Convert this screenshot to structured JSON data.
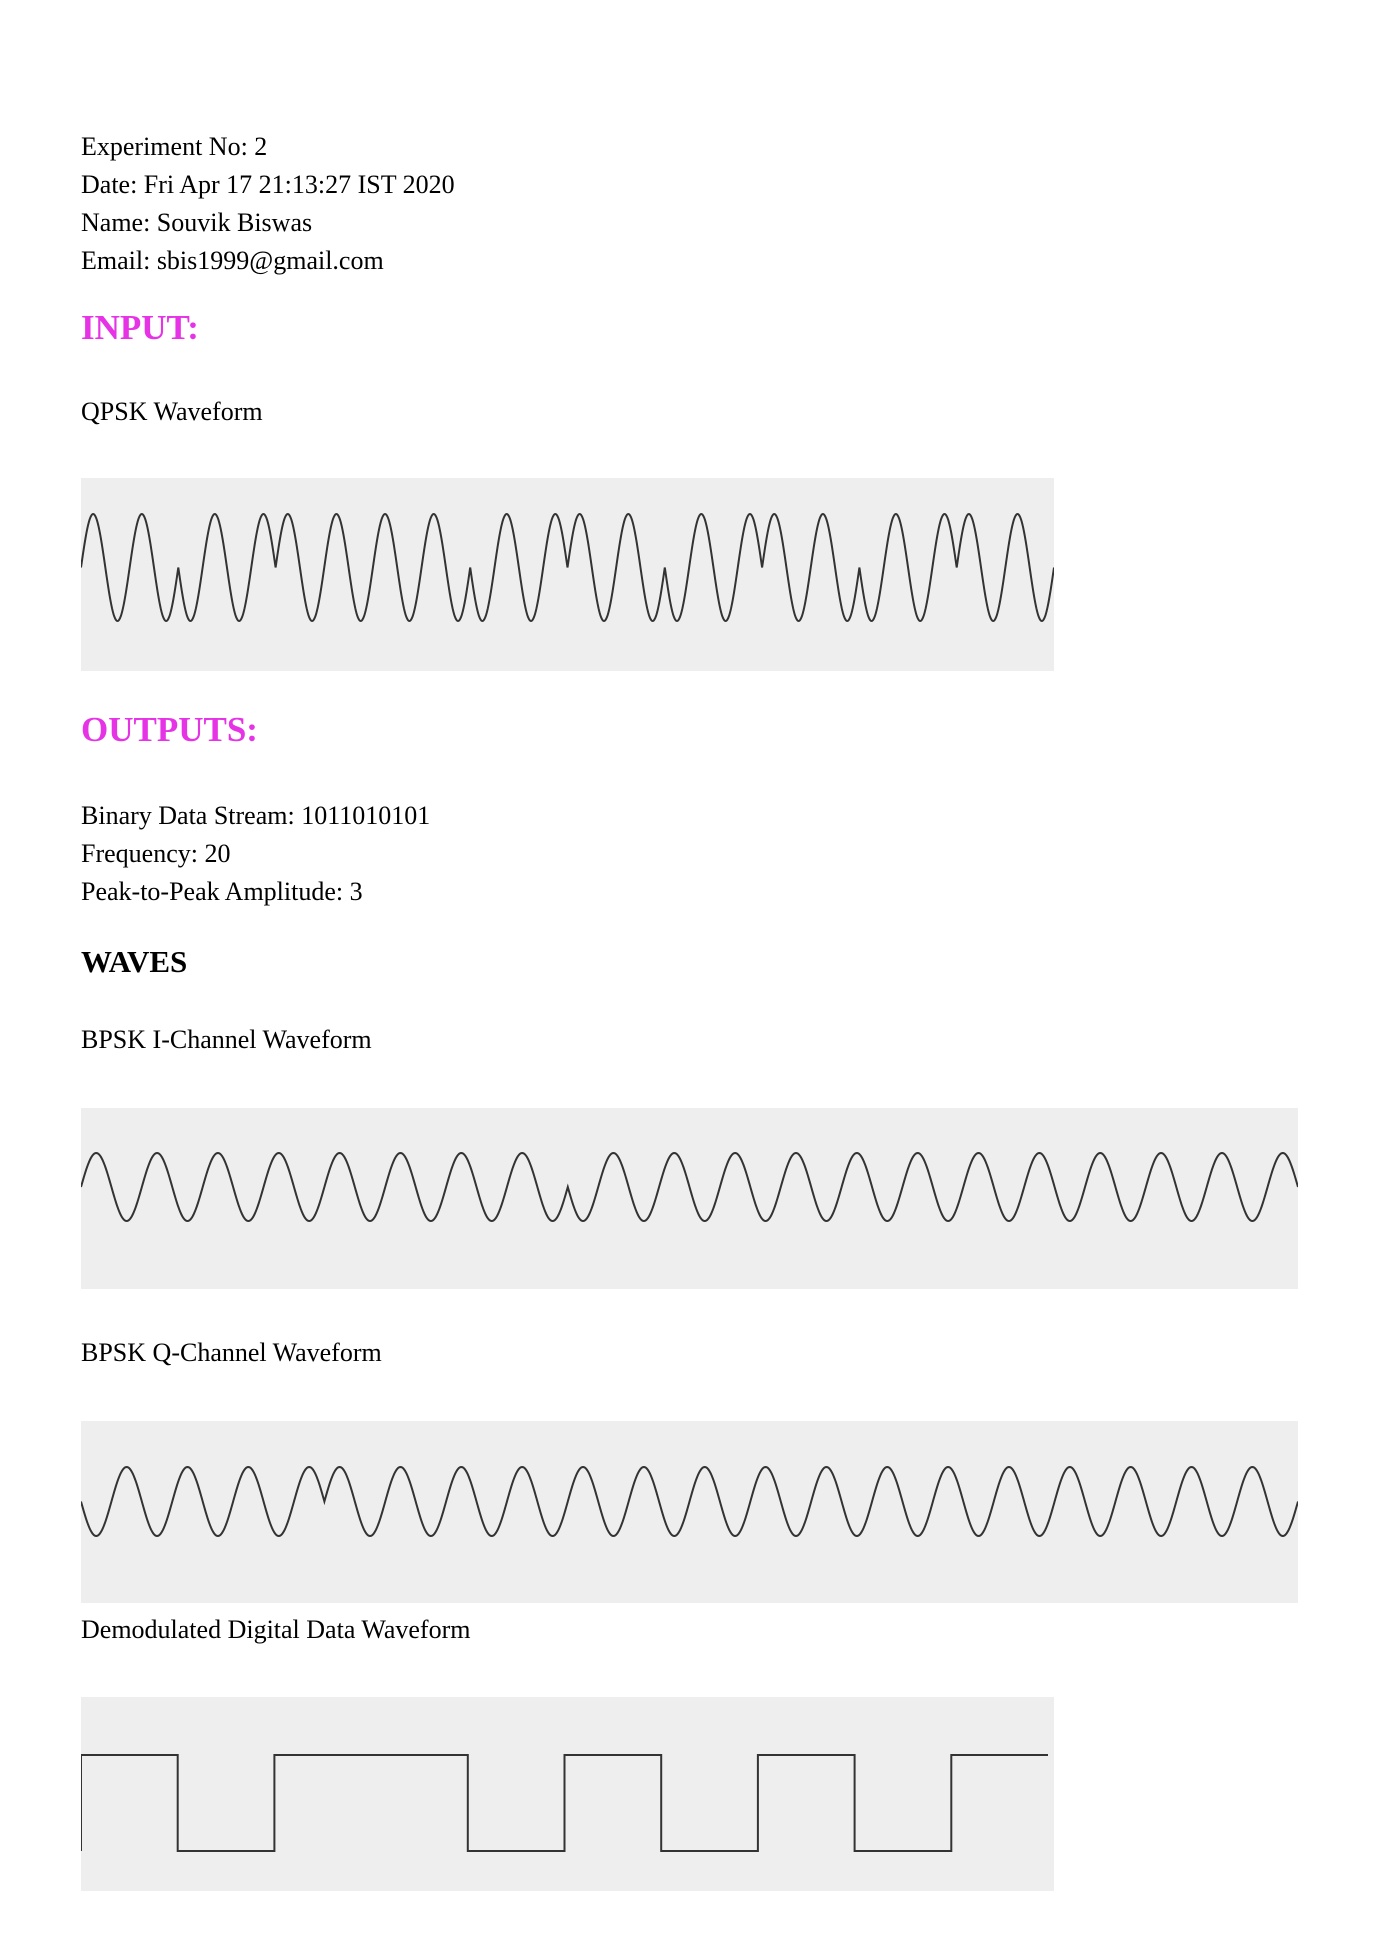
{
  "header": {
    "experiment": "Experiment No: 2",
    "date": "Date: Fri Apr 17 21:13:27 IST 2020",
    "name": "Name: Souvik Biswas",
    "email": "Email: sbis1999@gmail.com"
  },
  "colors": {
    "heading": "#e633e6",
    "wave_bg": "#eeeeee",
    "wave_stroke": "#333333"
  },
  "input": {
    "heading": "INPUT:",
    "qpsk_label": "QPSK Waveform"
  },
  "outputs": {
    "heading": "OUTPUTS:",
    "binary_stream": "Binary Data Stream: 1011010101",
    "frequency": "Frequency: 20",
    "amplitude": "Peak-to-Peak Amplitude: 3"
  },
  "waves": {
    "heading": "WAVES",
    "i_label": "BPSK I-Channel Waveform",
    "q_label": "BPSK Q-Channel Waveform",
    "demod_label": "Demodulated Digital Data Waveform"
  },
  "chart_data": [
    {
      "type": "line",
      "name_ref": "qpsk",
      "cycles": 20,
      "bits": [
        1,
        0,
        1,
        1,
        0,
        1,
        0,
        1,
        0,
        1
      ],
      "x": [
        0,
        1
      ],
      "ylim": [
        -1.5,
        1.5
      ]
    },
    {
      "type": "line",
      "name_ref": "bpsk-i",
      "cycles": 20,
      "bits": [
        1,
        1,
        0,
        0,
        0
      ],
      "ylim": [
        -1.5,
        1.5
      ]
    },
    {
      "type": "line",
      "name_ref": "bpsk-q",
      "cycles": 20,
      "bits": [
        0,
        1,
        1,
        1,
        1
      ],
      "ylim": [
        -1.5,
        1.5
      ]
    },
    {
      "type": "line",
      "name_ref": "demod",
      "bits": [
        1,
        0,
        1,
        1,
        0,
        1,
        0,
        1,
        0,
        1
      ],
      "ylim": [
        0,
        1
      ]
    }
  ]
}
